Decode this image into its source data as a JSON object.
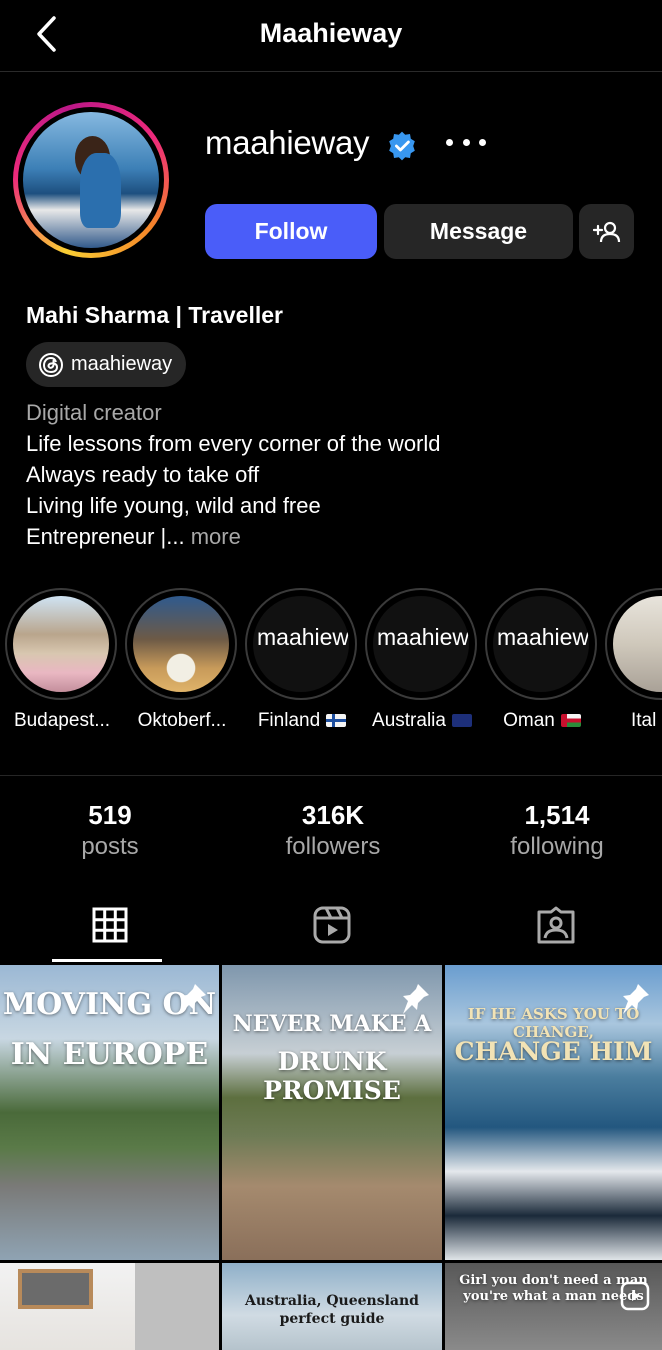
{
  "header": {
    "title": "Maahieway",
    "back_icon": "chevron-left-icon"
  },
  "profile": {
    "username": "maahieway",
    "verified_icon": "verified-badge-icon",
    "verified_color": "#3897f0",
    "full_name": "Mahi Sharma | Traveller",
    "threads_handle": "maahieway",
    "category": "Digital creator",
    "bio": [
      "Life lessons from every corner of the world",
      "Always ready to take off",
      "Living life young, wild and free",
      "Entrepreneur |..."
    ],
    "more_label": "more"
  },
  "actions": {
    "follow_label": "Follow",
    "message_label": "Message",
    "follow_color": "#4a5df9"
  },
  "highlights": [
    {
      "label": "Budapest..."
    },
    {
      "label": "Oktoberf..."
    },
    {
      "label": "Finland",
      "cover_text": "maahieway highlight"
    },
    {
      "label": "Australia",
      "cover_text": "maahieway highlight"
    },
    {
      "label": "Oman",
      "cover_text": "maahieway highlight"
    },
    {
      "label": "Ital"
    }
  ],
  "stats": [
    {
      "value": "519",
      "label": "posts"
    },
    {
      "value": "316K",
      "label": "followers"
    },
    {
      "value": "1,514",
      "label": "following"
    }
  ],
  "tabs": [
    {
      "icon": "grid-icon",
      "active": true
    },
    {
      "icon": "reels-icon",
      "active": false
    },
    {
      "icon": "tagged-icon",
      "active": false
    }
  ],
  "posts": [
    {
      "caption_top": "MOVING ON",
      "caption_bottom": "IN EUROPE",
      "pinned": true
    },
    {
      "caption_top": "NEVER MAKE A",
      "caption_bottom": "DRUNK PROMISE",
      "pinned": true
    },
    {
      "caption_top": "IF HE ASKS YOU TO CHANGE,",
      "caption_bottom": "CHANGE HIM",
      "pinned": true
    },
    {
      "caption_top": "",
      "caption_bottom": ""
    },
    {
      "caption_top": "Australia, Queensland",
      "caption_bottom": "perfect guide"
    },
    {
      "caption_top": "Girl you don't need a man",
      "caption_bottom": "you're what a man needs"
    }
  ]
}
